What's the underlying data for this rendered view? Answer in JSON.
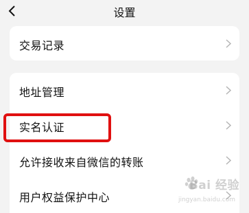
{
  "header": {
    "back_icon": "chevron-left-icon",
    "title": "设置"
  },
  "section1": {
    "items": [
      {
        "label": "交易记录",
        "icon": "chevron-right-icon"
      }
    ]
  },
  "section2": {
    "items": [
      {
        "label": "地址管理",
        "icon": "chevron-right-icon"
      },
      {
        "label": "实名认证",
        "icon": "chevron-right-icon",
        "highlighted": true
      },
      {
        "label": "允许接收来自微信的转账",
        "icon": "chevron-right-icon"
      },
      {
        "label": "用户权益保护中心",
        "icon": "chevron-right-icon"
      }
    ]
  },
  "annotation": {
    "highlight_color": "#e01010"
  },
  "watermark": {
    "text": "Bai 经验",
    "sub": "jingyan.baidu.com"
  },
  "colors": {
    "background": "#f3f3f3",
    "card": "#ffffff",
    "chevron": "#b5b5b5"
  }
}
